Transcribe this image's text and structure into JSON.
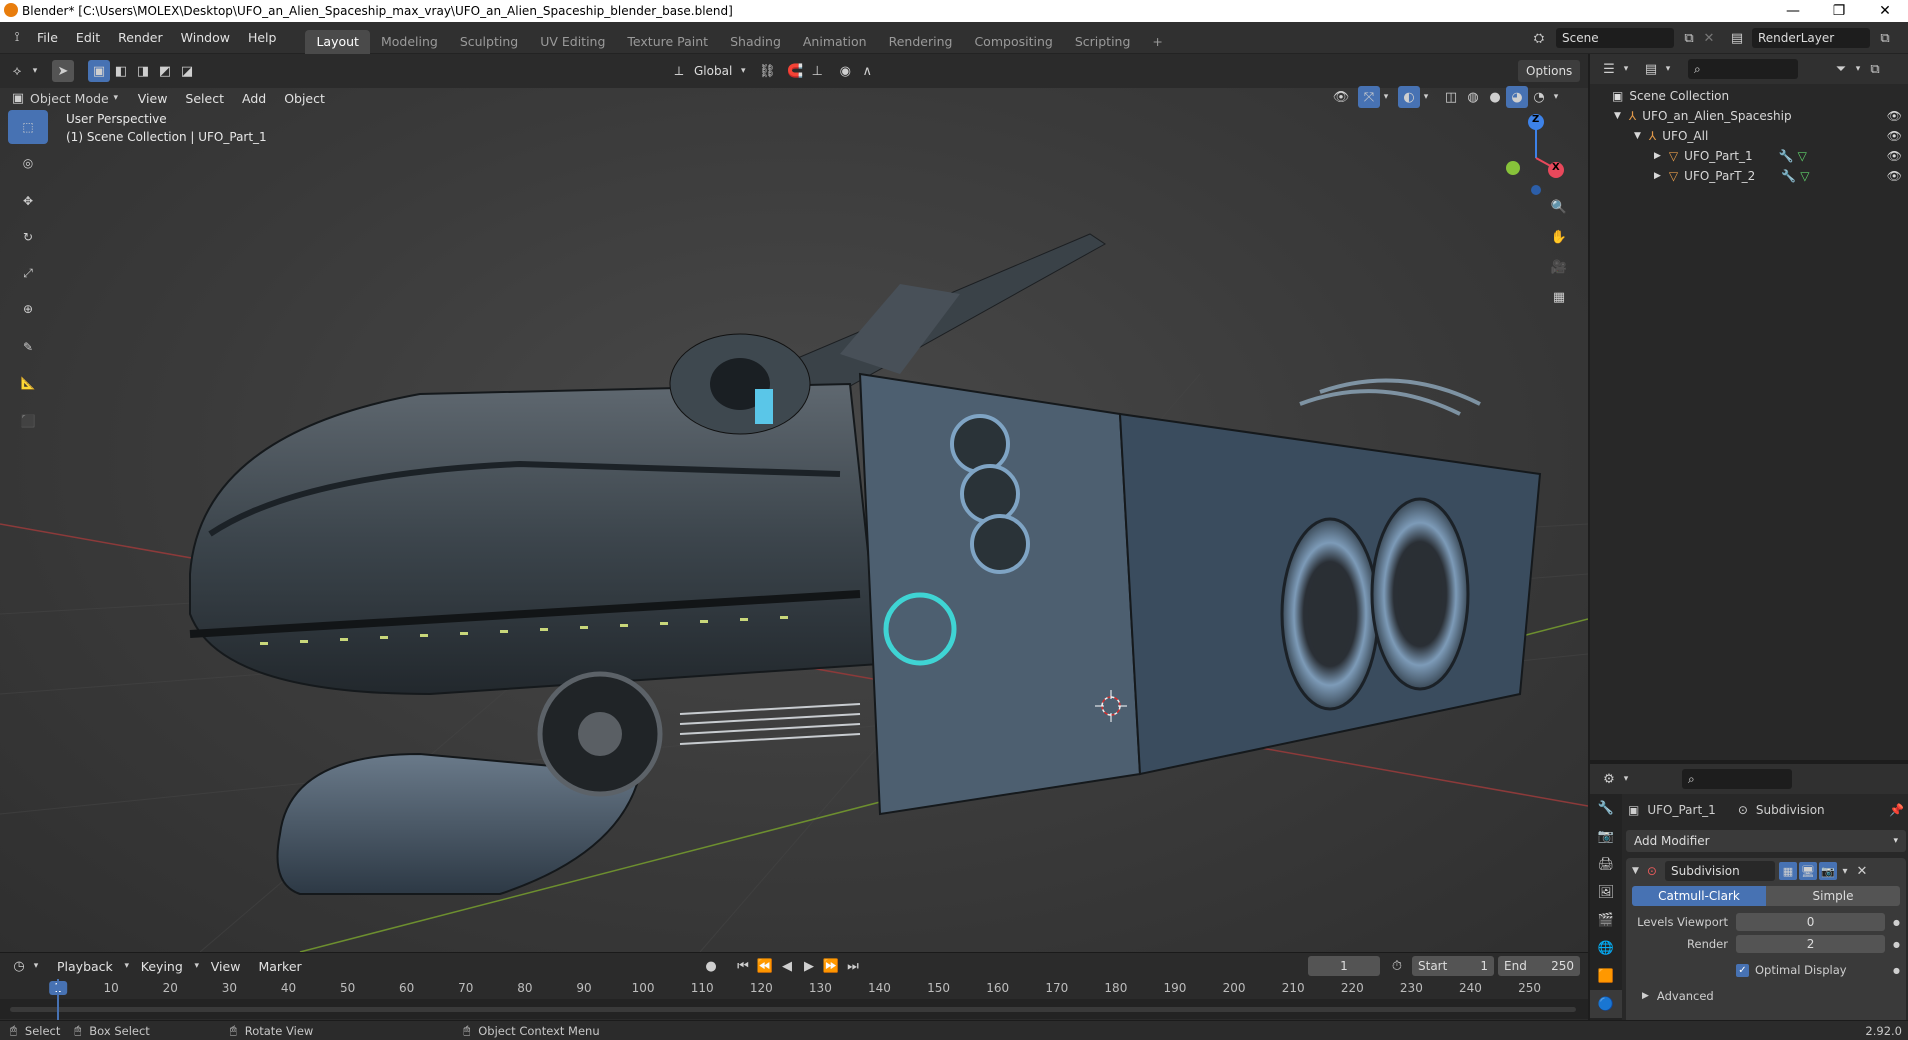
{
  "window": {
    "title": "Blender* [C:\\Users\\MOLEX\\Desktop\\UFO_an_Alien_Spaceship_max_vray\\UFO_an_Alien_Spaceship_blender_base.blend]"
  },
  "menu": {
    "items": [
      "File",
      "Edit",
      "Render",
      "Window",
      "Help"
    ]
  },
  "workspaces": {
    "tabs": [
      "Layout",
      "Modeling",
      "Sculpting",
      "UV Editing",
      "Texture Paint",
      "Shading",
      "Animation",
      "Rendering",
      "Compositing",
      "Scripting"
    ],
    "add": "+"
  },
  "scene": {
    "name": "Scene",
    "render_layer": "RenderLayer"
  },
  "viewport": {
    "transform_orientation": "Global",
    "options_label": "Options",
    "mode": "Object Mode",
    "header_menus": [
      "View",
      "Select",
      "Add",
      "Object"
    ],
    "overlay_title": "User Perspective",
    "overlay_subtitle": "(1) Scene Collection | UFO_Part_1",
    "gizmo": {
      "x": "X",
      "y": "Y",
      "z": "Z"
    }
  },
  "outliner": {
    "root": "Scene Collection",
    "items": [
      {
        "name": "UFO_an_Alien_Spaceship",
        "depth": 1
      },
      {
        "name": "UFO_All",
        "depth": 2
      },
      {
        "name": "UFO_Part_1",
        "depth": 3
      },
      {
        "name": "UFO_ParT_2",
        "depth": 3
      }
    ]
  },
  "properties": {
    "object_name": "UFO_Part_1",
    "modifier_tab": "Subdivision",
    "add_modifier": "Add Modifier",
    "modifier": {
      "name": "Subdivision",
      "type_a": "Catmull-Clark",
      "type_b": "Simple",
      "levels_viewport_label": "Levels Viewport",
      "levels_viewport": "0",
      "render_label": "Render",
      "render": "2",
      "optimal_display": "Optimal Display",
      "advanced": "Advanced"
    }
  },
  "timeline": {
    "menus": [
      "Playback",
      "Keying",
      "View",
      "Marker"
    ],
    "current_frame": "1",
    "start_label": "Start",
    "start": "1",
    "end_label": "End",
    "end": "250",
    "ticks": [
      "1",
      "10",
      "20",
      "30",
      "40",
      "50",
      "60",
      "70",
      "80",
      "90",
      "100",
      "110",
      "120",
      "130",
      "140",
      "150",
      "160",
      "170",
      "180",
      "190",
      "200",
      "210",
      "220",
      "230",
      "240",
      "250"
    ]
  },
  "statusbar": {
    "select": "Select",
    "box_select": "Box Select",
    "rotate_view": "Rotate View",
    "context_menu": "Object Context Menu",
    "version": "2.92.0"
  },
  "colors": {
    "accent": "#4772b3",
    "header": "#303030",
    "panel": "#282828",
    "axis_x": "#e8485b",
    "axis_y": "#87c23a",
    "axis_z": "#3d82e8"
  }
}
